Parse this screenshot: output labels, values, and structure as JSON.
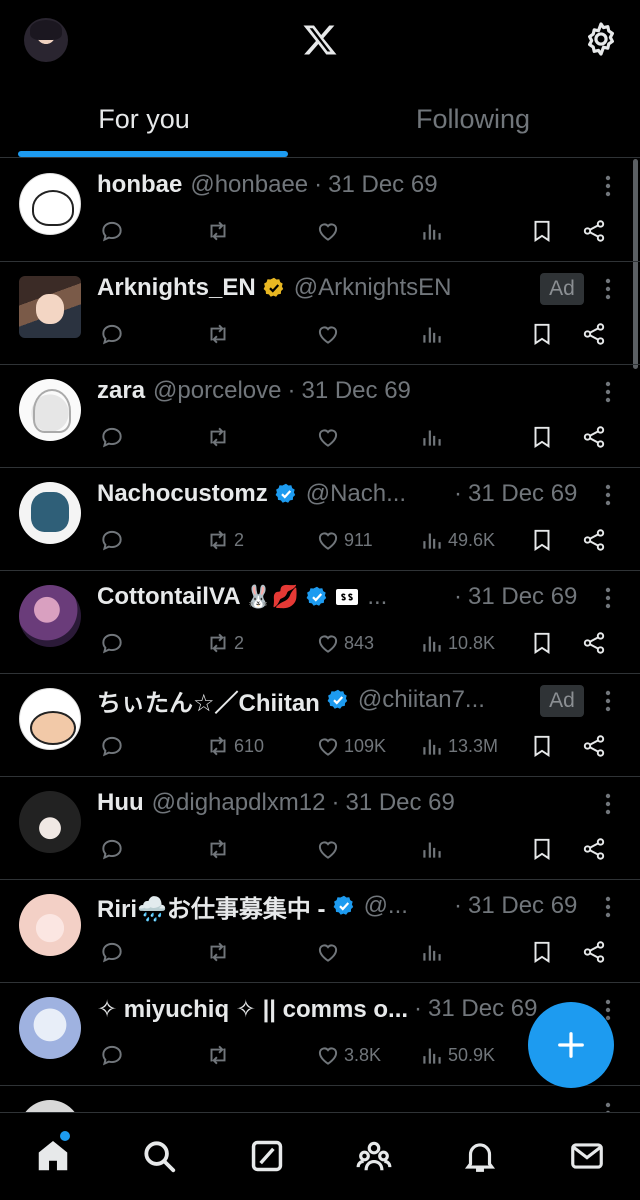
{
  "header": {
    "logo": "X",
    "tabs": [
      {
        "label": "For you",
        "active": true
      },
      {
        "label": "Following",
        "active": false
      }
    ]
  },
  "posts": [
    {
      "name": "honbae",
      "handle": "@honbaee",
      "date": "31 Dec 69",
      "verified": false,
      "ad": false,
      "retweets": "",
      "likes": "",
      "views": ""
    },
    {
      "name": "Arknights_EN",
      "handle": "@ArknightsEN",
      "date": "",
      "verified": true,
      "verified_color": "#e8b722",
      "ad": true,
      "ad_label": "Ad",
      "retweets": "",
      "likes": "",
      "views": ""
    },
    {
      "name": "zara",
      "handle": "@porcelove",
      "date": "31 Dec 69",
      "verified": false,
      "ad": false,
      "retweets": "",
      "likes": "",
      "views": ""
    },
    {
      "name": "Nachocustomz",
      "handle": "@Nach...",
      "date": "31 Dec 69",
      "verified": true,
      "ad": false,
      "retweets": "2",
      "likes": "911",
      "views": "49.6K"
    },
    {
      "name": "CottontailVA",
      "name_emoji": "🐰💋",
      "handle": "...",
      "date": "31 Dec 69",
      "verified": true,
      "ad": false,
      "retweets": "2",
      "likes": "843",
      "views": "10.8K"
    },
    {
      "name": "ちぃたん☆／Chiitan",
      "handle": "@chiitan7...",
      "date": "",
      "verified": true,
      "ad": true,
      "ad_label": "Ad",
      "retweets": "610",
      "likes": "109K",
      "views": "13.3M"
    },
    {
      "name": "Huu",
      "handle": "@dighapdlxm12",
      "date": "31 Dec 69",
      "verified": false,
      "ad": false,
      "retweets": "",
      "likes": "",
      "views": ""
    },
    {
      "name": "Riri🌧️お仕事募集中 -",
      "handle": "@...",
      "date": "31 Dec 69",
      "verified": true,
      "ad": false,
      "retweets": "",
      "likes": "",
      "views": ""
    },
    {
      "name": "✧ miyuchiq ✧ || comms o...",
      "handle": "",
      "date": "31 Dec 69",
      "verified": false,
      "ad": false,
      "retweets": "",
      "likes": "3.8K",
      "views": "50.9K"
    }
  ],
  "colors": {
    "accent": "#1d9bf0",
    "background": "#000000",
    "muted": "#71767b",
    "divider": "#2f3336"
  },
  "icons": {
    "nav": [
      "home-icon",
      "search-icon",
      "grok-icon",
      "communities-icon",
      "notifications-icon",
      "messages-icon"
    ]
  },
  "fab": {
    "icon": "plus-icon"
  }
}
